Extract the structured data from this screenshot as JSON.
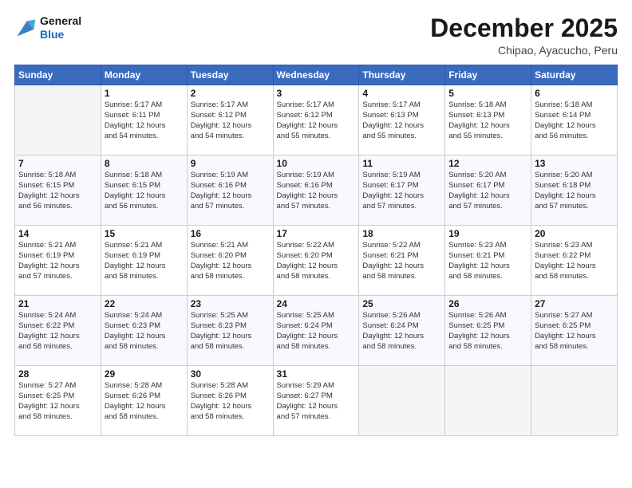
{
  "header": {
    "logo_line1": "General",
    "logo_line2": "Blue",
    "month": "December 2025",
    "location": "Chipao, Ayacucho, Peru"
  },
  "weekdays": [
    "Sunday",
    "Monday",
    "Tuesday",
    "Wednesday",
    "Thursday",
    "Friday",
    "Saturday"
  ],
  "weeks": [
    [
      {
        "day": "",
        "info": ""
      },
      {
        "day": "1",
        "info": "Sunrise: 5:17 AM\nSunset: 6:11 PM\nDaylight: 12 hours\nand 54 minutes."
      },
      {
        "day": "2",
        "info": "Sunrise: 5:17 AM\nSunset: 6:12 PM\nDaylight: 12 hours\nand 54 minutes."
      },
      {
        "day": "3",
        "info": "Sunrise: 5:17 AM\nSunset: 6:12 PM\nDaylight: 12 hours\nand 55 minutes."
      },
      {
        "day": "4",
        "info": "Sunrise: 5:17 AM\nSunset: 6:13 PM\nDaylight: 12 hours\nand 55 minutes."
      },
      {
        "day": "5",
        "info": "Sunrise: 5:18 AM\nSunset: 6:13 PM\nDaylight: 12 hours\nand 55 minutes."
      },
      {
        "day": "6",
        "info": "Sunrise: 5:18 AM\nSunset: 6:14 PM\nDaylight: 12 hours\nand 56 minutes."
      }
    ],
    [
      {
        "day": "7",
        "info": "Sunrise: 5:18 AM\nSunset: 6:15 PM\nDaylight: 12 hours\nand 56 minutes."
      },
      {
        "day": "8",
        "info": "Sunrise: 5:18 AM\nSunset: 6:15 PM\nDaylight: 12 hours\nand 56 minutes."
      },
      {
        "day": "9",
        "info": "Sunrise: 5:19 AM\nSunset: 6:16 PM\nDaylight: 12 hours\nand 57 minutes."
      },
      {
        "day": "10",
        "info": "Sunrise: 5:19 AM\nSunset: 6:16 PM\nDaylight: 12 hours\nand 57 minutes."
      },
      {
        "day": "11",
        "info": "Sunrise: 5:19 AM\nSunset: 6:17 PM\nDaylight: 12 hours\nand 57 minutes."
      },
      {
        "day": "12",
        "info": "Sunrise: 5:20 AM\nSunset: 6:17 PM\nDaylight: 12 hours\nand 57 minutes."
      },
      {
        "day": "13",
        "info": "Sunrise: 5:20 AM\nSunset: 6:18 PM\nDaylight: 12 hours\nand 57 minutes."
      }
    ],
    [
      {
        "day": "14",
        "info": "Sunrise: 5:21 AM\nSunset: 6:19 PM\nDaylight: 12 hours\nand 57 minutes."
      },
      {
        "day": "15",
        "info": "Sunrise: 5:21 AM\nSunset: 6:19 PM\nDaylight: 12 hours\nand 58 minutes."
      },
      {
        "day": "16",
        "info": "Sunrise: 5:21 AM\nSunset: 6:20 PM\nDaylight: 12 hours\nand 58 minutes."
      },
      {
        "day": "17",
        "info": "Sunrise: 5:22 AM\nSunset: 6:20 PM\nDaylight: 12 hours\nand 58 minutes."
      },
      {
        "day": "18",
        "info": "Sunrise: 5:22 AM\nSunset: 6:21 PM\nDaylight: 12 hours\nand 58 minutes."
      },
      {
        "day": "19",
        "info": "Sunrise: 5:23 AM\nSunset: 6:21 PM\nDaylight: 12 hours\nand 58 minutes."
      },
      {
        "day": "20",
        "info": "Sunrise: 5:23 AM\nSunset: 6:22 PM\nDaylight: 12 hours\nand 58 minutes."
      }
    ],
    [
      {
        "day": "21",
        "info": "Sunrise: 5:24 AM\nSunset: 6:22 PM\nDaylight: 12 hours\nand 58 minutes."
      },
      {
        "day": "22",
        "info": "Sunrise: 5:24 AM\nSunset: 6:23 PM\nDaylight: 12 hours\nand 58 minutes."
      },
      {
        "day": "23",
        "info": "Sunrise: 5:25 AM\nSunset: 6:23 PM\nDaylight: 12 hours\nand 58 minutes."
      },
      {
        "day": "24",
        "info": "Sunrise: 5:25 AM\nSunset: 6:24 PM\nDaylight: 12 hours\nand 58 minutes."
      },
      {
        "day": "25",
        "info": "Sunrise: 5:26 AM\nSunset: 6:24 PM\nDaylight: 12 hours\nand 58 minutes."
      },
      {
        "day": "26",
        "info": "Sunrise: 5:26 AM\nSunset: 6:25 PM\nDaylight: 12 hours\nand 58 minutes."
      },
      {
        "day": "27",
        "info": "Sunrise: 5:27 AM\nSunset: 6:25 PM\nDaylight: 12 hours\nand 58 minutes."
      }
    ],
    [
      {
        "day": "28",
        "info": "Sunrise: 5:27 AM\nSunset: 6:25 PM\nDaylight: 12 hours\nand 58 minutes."
      },
      {
        "day": "29",
        "info": "Sunrise: 5:28 AM\nSunset: 6:26 PM\nDaylight: 12 hours\nand 58 minutes."
      },
      {
        "day": "30",
        "info": "Sunrise: 5:28 AM\nSunset: 6:26 PM\nDaylight: 12 hours\nand 58 minutes."
      },
      {
        "day": "31",
        "info": "Sunrise: 5:29 AM\nSunset: 6:27 PM\nDaylight: 12 hours\nand 57 minutes."
      },
      {
        "day": "",
        "info": ""
      },
      {
        "day": "",
        "info": ""
      },
      {
        "day": "",
        "info": ""
      }
    ]
  ]
}
